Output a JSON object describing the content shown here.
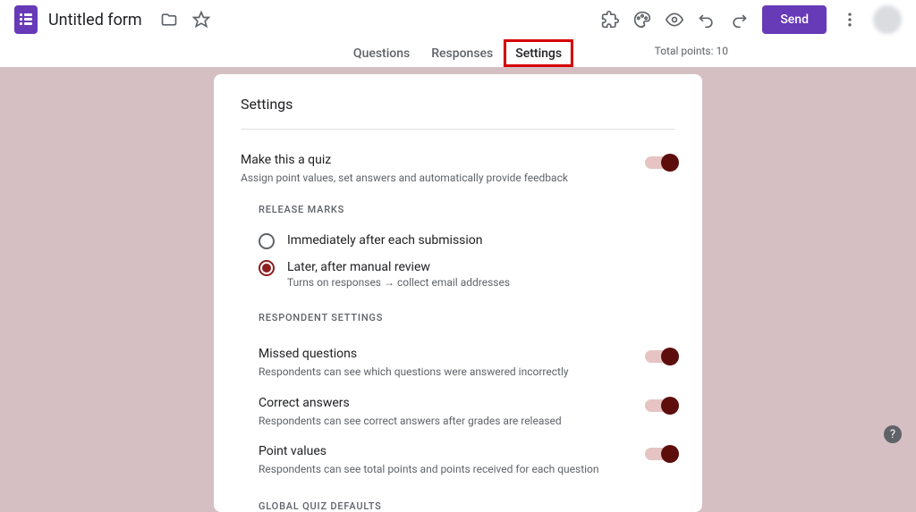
{
  "header": {
    "title": "Untitled form",
    "send_label": "Send"
  },
  "tabs": {
    "questions": "Questions",
    "responses": "Responses",
    "settings": "Settings",
    "points": "Total points: 10"
  },
  "card": {
    "title": "Settings",
    "quiz": {
      "title": "Make this a quiz",
      "desc": "Assign point values, set answers and automatically provide feedback"
    },
    "release_marks_label": "RELEASE MARKS",
    "release_immediate": "Immediately after each submission",
    "release_later": {
      "label": "Later, after manual review",
      "desc": "Turns on responses → collect email addresses"
    },
    "respondent_label": "RESPONDENT SETTINGS",
    "missed": {
      "title": "Missed questions",
      "desc": "Respondents can see which questions were answered incorrectly"
    },
    "correct": {
      "title": "Correct answers",
      "desc": "Respondents can see correct answers after grades are released"
    },
    "point_values": {
      "title": "Point values",
      "desc": "Respondents can see total points and points received for each question"
    },
    "global_defaults_label": "GLOBAL QUIZ DEFAULTS"
  }
}
